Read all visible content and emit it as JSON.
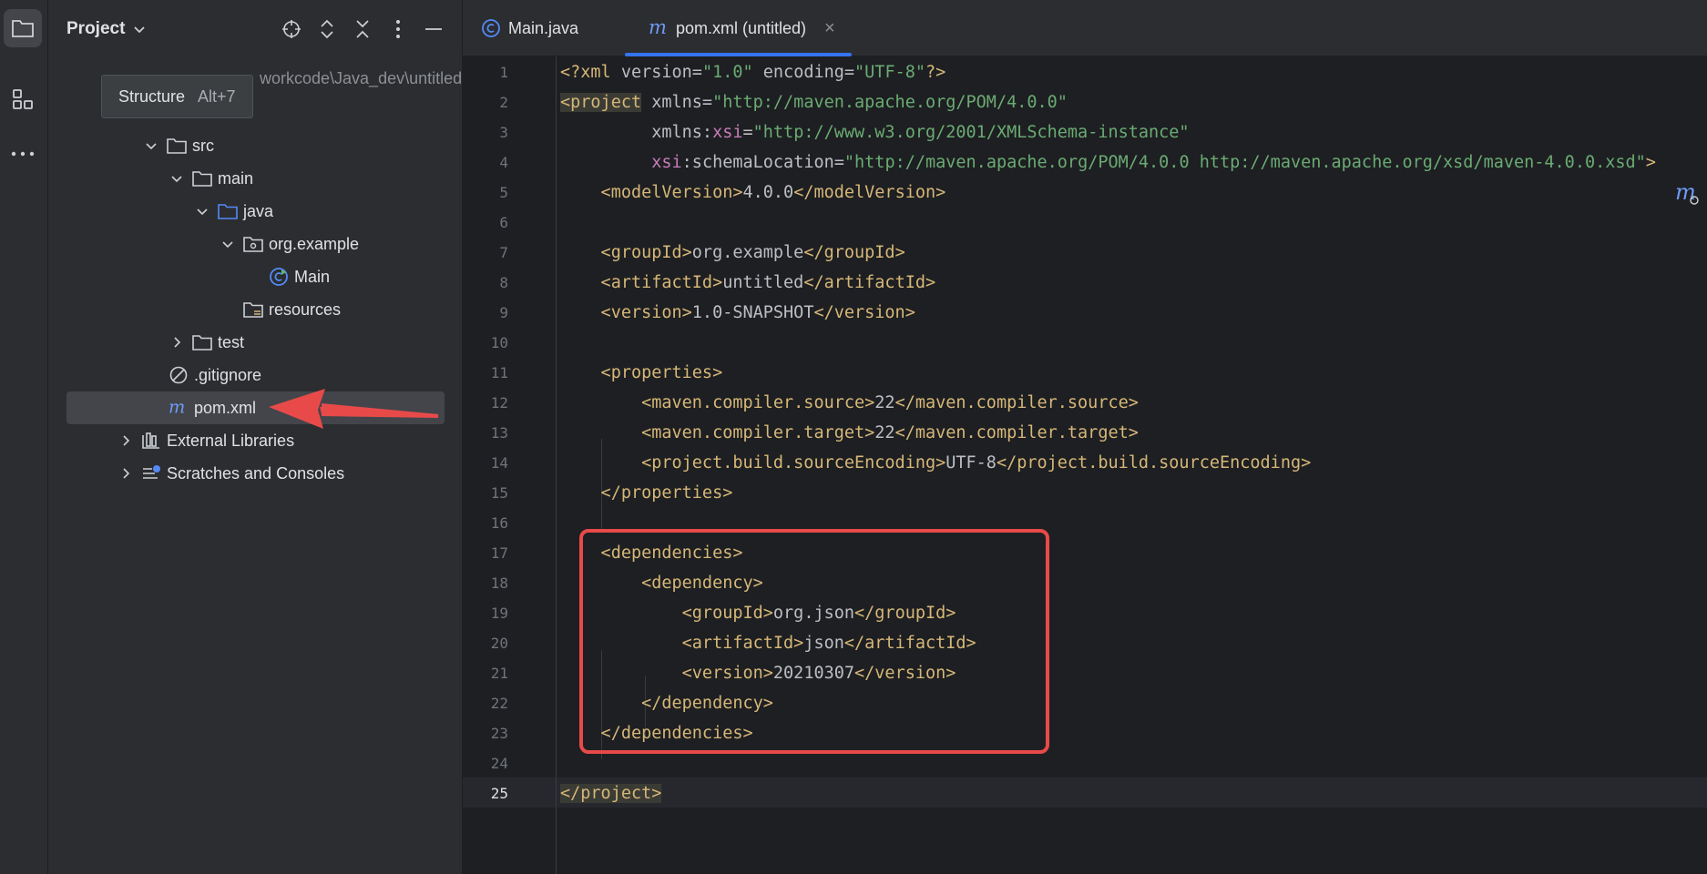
{
  "panel": {
    "title": "Project",
    "tooltip": {
      "label": "Structure",
      "shortcut": "Alt+7"
    },
    "path_suffix": "workcode\\Java_dev\\untitled",
    "tree": [
      {
        "label": "src",
        "icon": "folder-icon",
        "expanded": true
      },
      {
        "label": "main",
        "icon": "folder-icon",
        "expanded": true
      },
      {
        "label": "java",
        "icon": "source-folder-icon",
        "expanded": true
      },
      {
        "label": "org.example",
        "icon": "package-icon",
        "expanded": true
      },
      {
        "label": "Main",
        "icon": "java-class-icon"
      },
      {
        "label": "resources",
        "icon": "resources-folder-icon"
      },
      {
        "label": "test",
        "icon": "folder-icon",
        "expanded": false
      },
      {
        "label": ".gitignore",
        "icon": "ignore-file-icon"
      },
      {
        "label": "pom.xml",
        "icon": "maven-icon",
        "selected": true
      },
      {
        "label": "External Libraries",
        "icon": "libraries-icon",
        "expanded": false
      },
      {
        "label": "Scratches and Consoles",
        "icon": "scratches-icon",
        "expanded": false
      }
    ]
  },
  "tabs": [
    {
      "label": "Main.java",
      "icon": "java-class-icon"
    },
    {
      "label": "pom.xml (untitled)",
      "icon": "maven-icon",
      "active": true,
      "close": "×"
    }
  ],
  "editor": {
    "current_line": 25,
    "lines": [
      "<?xml version=\"1.0\" encoding=\"UTF-8\"?>",
      "<project xmlns=\"http://maven.apache.org/POM/4.0.0\"",
      "         xmlns:xsi=\"http://www.w3.org/2001/XMLSchema-instance\"",
      "         xsi:schemaLocation=\"http://maven.apache.org/POM/4.0.0 http://maven.apache.org/xsd/maven-4.0.0.xsd\">",
      "    <modelVersion>4.0.0</modelVersion>",
      "",
      "    <groupId>org.example</groupId>",
      "    <artifactId>untitled</artifactId>",
      "    <version>1.0-SNAPSHOT</version>",
      "",
      "    <properties>",
      "        <maven.compiler.source>22</maven.compiler.source>",
      "        <maven.compiler.target>22</maven.compiler.target>",
      "        <project.build.sourceEncoding>UTF-8</project.build.sourceEncoding>",
      "    </properties>",
      "",
      "    <dependencies>",
      "        <dependency>",
      "            <groupId>org.json</groupId>",
      "            <artifactId>json</artifactId>",
      "            <version>20210307</version>",
      "        </dependency>",
      "    </dependencies>",
      "",
      "</project>"
    ]
  },
  "colors": {
    "tag": "#d5b778",
    "string": "#6aab73",
    "namespace": "#c77dbb",
    "accent": "#3574f0",
    "annotation_red": "#e84a4a"
  }
}
